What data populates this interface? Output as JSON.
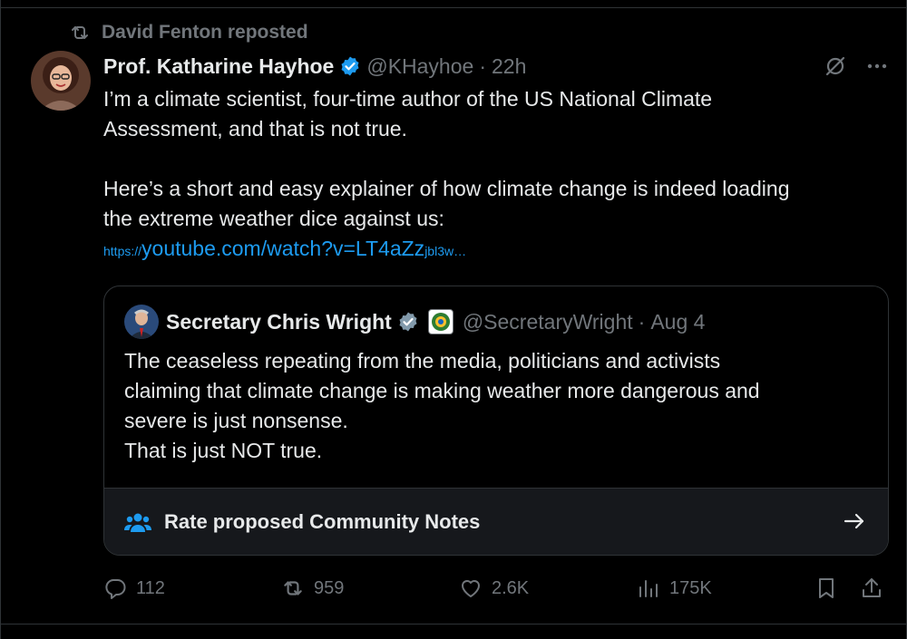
{
  "repost": {
    "icon": "repost-icon",
    "text": "David Fenton reposted"
  },
  "tweet": {
    "author": "Prof. Katharine Hayhoe",
    "handle": "@KHayhoe",
    "separator": "·",
    "time": "22h",
    "text_line1": "I’m a climate scientist, four-time author of the US National Climate",
    "text_line2": "Assessment, and that is not true.",
    "text_line3": "Here’s a short and easy explainer of how climate change is indeed loading",
    "text_line4": "the extreme weather dice against us:",
    "link_prefix": "https://",
    "link_main": "youtube.com/watch?v=LT4aZz",
    "link_suffix": "jbl3w…"
  },
  "quote": {
    "author": "Secretary Chris Wright",
    "handle": "@SecretaryWright",
    "separator": "·",
    "date": "Aug 4",
    "line1": "The ceaseless repeating from the media, politicians and activists",
    "line2": "claiming that climate change is making weather more dangerous and",
    "line3": "severe is just nonsense.",
    "line4": "That is just NOT true.",
    "notes_label": "Rate proposed Community Notes"
  },
  "actions": {
    "replies": "112",
    "reposts": "959",
    "likes": "2.6K",
    "views": "175K"
  },
  "colors": {
    "accent": "#1d9bf0",
    "muted": "#71767b",
    "text": "#e7e9ea",
    "background": "#000000"
  }
}
